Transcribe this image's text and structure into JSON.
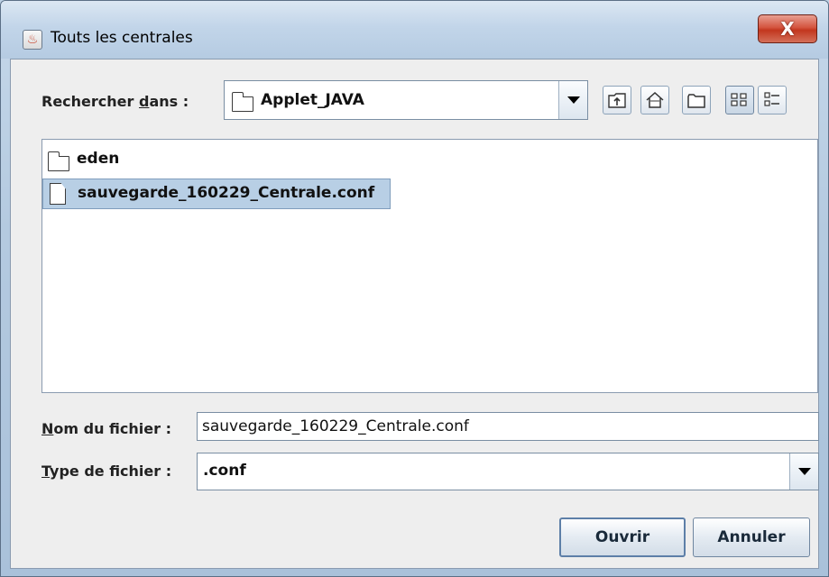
{
  "window": {
    "title": "Touts les centrales",
    "close_glyph": "X"
  },
  "look_in": {
    "label_pre": "Rechercher ",
    "label_mnemonic": "d",
    "label_post": "ans :",
    "value": "Applet_JAVA"
  },
  "toolbar": {
    "icons": [
      "up-folder-icon",
      "home-icon",
      "new-folder-icon",
      "list-view-icon",
      "details-view-icon"
    ]
  },
  "files": [
    {
      "name": "eden",
      "type": "folder",
      "selected": false
    },
    {
      "name": "sauvegarde_160229_Centrale.conf",
      "type": "file",
      "selected": true
    }
  ],
  "filename": {
    "label_mnemonic": "N",
    "label_rest": "om du fichier :",
    "value": "sauvegarde_160229_Centrale.conf"
  },
  "filetype": {
    "label_mnemonic": "T",
    "label_rest": "ype de fichier :",
    "value": ".conf"
  },
  "buttons": {
    "open": "Ouvrir",
    "cancel": "Annuler"
  }
}
